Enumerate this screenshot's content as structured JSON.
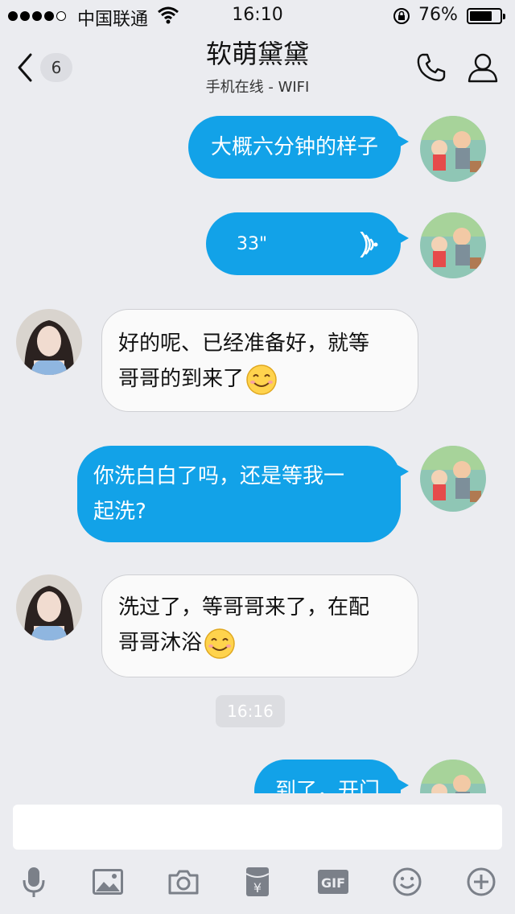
{
  "status_bar": {
    "carrier": "中国联通",
    "time": "16:10",
    "battery": "76%",
    "battery_level": 0.76
  },
  "header": {
    "back_count": "6",
    "title": "软萌黛黛",
    "subtitle": "手机在线 - WIFI"
  },
  "messages": [
    {
      "side": "out",
      "type": "text",
      "text": "大概六分钟的样子"
    },
    {
      "side": "out",
      "type": "voice",
      "duration": "33\""
    },
    {
      "side": "in",
      "type": "text",
      "line1": "好的呢、已经准备好，就等",
      "line2": "哥哥的到来了"
    },
    {
      "side": "out",
      "type": "text",
      "line1": "你洗白白了吗，还是等我一",
      "line2": "起洗?"
    },
    {
      "side": "in",
      "type": "text",
      "line1": "洗过了，等哥哥来了，在配",
      "line2": "哥哥沐浴"
    },
    {
      "side": "out",
      "type": "text",
      "text": "到了，开门"
    }
  ],
  "timestamp": "16:16",
  "input": {
    "placeholder": ""
  },
  "toolbar": {
    "gif_label": "GIF",
    "money_glyph": "¥"
  },
  "colors": {
    "accent": "#12a2e8",
    "background": "#ebecf0",
    "incoming_bubble": "#fafafa"
  }
}
